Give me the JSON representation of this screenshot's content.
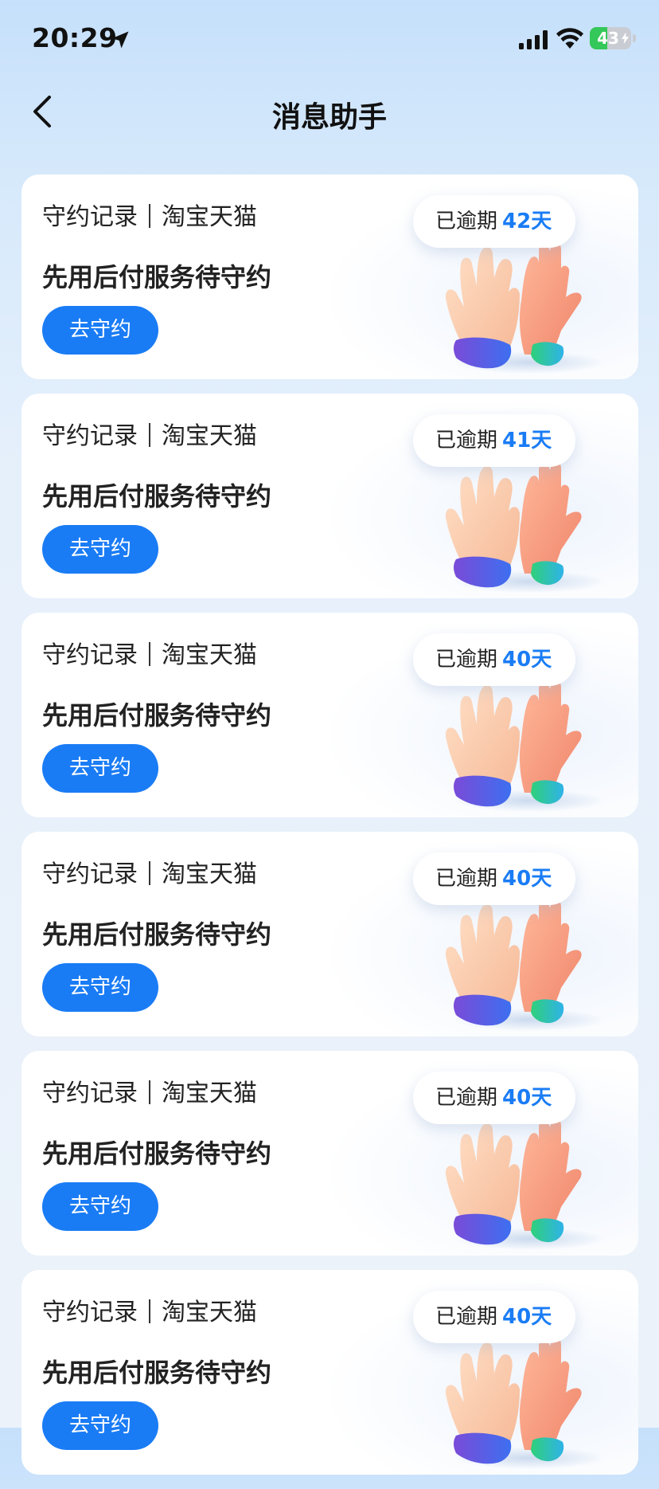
{
  "status_bar": {
    "time": "20:29",
    "battery": "43",
    "battery_level": 0.43,
    "icons": [
      "location-arrow-icon",
      "signal-icon",
      "wifi-icon",
      "battery-charging-icon"
    ]
  },
  "header": {
    "title": "消息助手",
    "back_icon": "chevron-left-icon"
  },
  "colors": {
    "accent": "#1a7cf5",
    "background_top": "#c6e0fb",
    "card": "#ffffff"
  },
  "cards": [
    {
      "source_type": "守约记录",
      "source_name": "淘宝天猫",
      "title": "先用后付服务待守约",
      "button": "去守约",
      "overdue_label": "已逾期",
      "overdue_days": "42天",
      "illustration": "high-five-hands-icon"
    },
    {
      "source_type": "守约记录",
      "source_name": "淘宝天猫",
      "title": "先用后付服务待守约",
      "button": "去守约",
      "overdue_label": "已逾期",
      "overdue_days": "41天",
      "illustration": "high-five-hands-icon"
    },
    {
      "source_type": "守约记录",
      "source_name": "淘宝天猫",
      "title": "先用后付服务待守约",
      "button": "去守约",
      "overdue_label": "已逾期",
      "overdue_days": "40天",
      "illustration": "high-five-hands-icon"
    },
    {
      "source_type": "守约记录",
      "source_name": "淘宝天猫",
      "title": "先用后付服务待守约",
      "button": "去守约",
      "overdue_label": "已逾期",
      "overdue_days": "40天",
      "illustration": "high-five-hands-icon"
    },
    {
      "source_type": "守约记录",
      "source_name": "淘宝天猫",
      "title": "先用后付服务待守约",
      "button": "去守约",
      "overdue_label": "已逾期",
      "overdue_days": "40天",
      "illustration": "high-five-hands-icon"
    },
    {
      "source_type": "守约记录",
      "source_name": "淘宝天猫",
      "title": "先用后付服务待守约",
      "button": "去守约",
      "overdue_label": "已逾期",
      "overdue_days": "40天",
      "illustration": "high-five-hands-icon"
    }
  ]
}
